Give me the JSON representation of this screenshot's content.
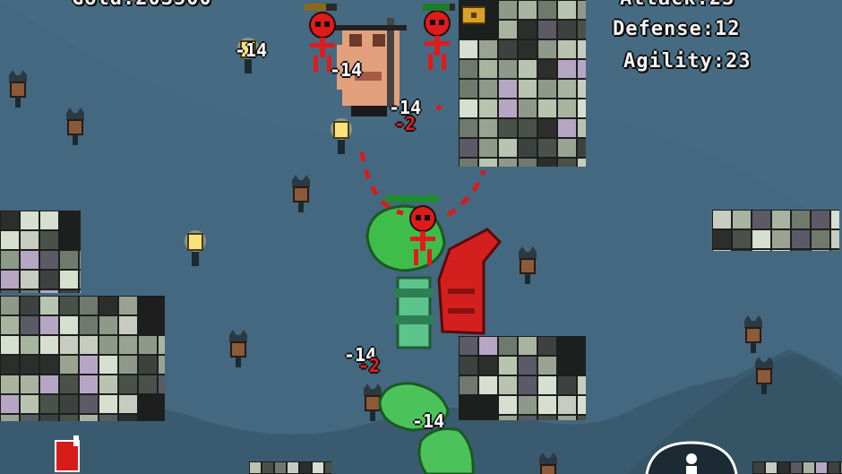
{
  "hud": {
    "gold": "Gold:203500",
    "attack": "Attack:23",
    "defense": "Defense:12",
    "agility": "Agility:23"
  },
  "damage_numbers": [
    {
      "text": "-14",
      "color": "white"
    },
    {
      "text": "-14",
      "color": "white"
    },
    {
      "text": "-14",
      "color": "white"
    },
    {
      "text": "-2",
      "color": "red"
    },
    {
      "text": "-14",
      "color": "white"
    },
    {
      "text": "-2",
      "color": "red"
    },
    {
      "text": "-14",
      "color": "white"
    }
  ],
  "colors": {
    "sky": "#44687f",
    "mountain": "#3a5b6f",
    "enemy_red": "#e01b1b",
    "player_green": "#3fb85a",
    "hud_text": "#f2f2f2"
  },
  "icons": [
    "lantern-icon",
    "bat-icon",
    "stick-figure-icon",
    "dragon-icon",
    "ability-icon",
    "card-icon"
  ]
}
